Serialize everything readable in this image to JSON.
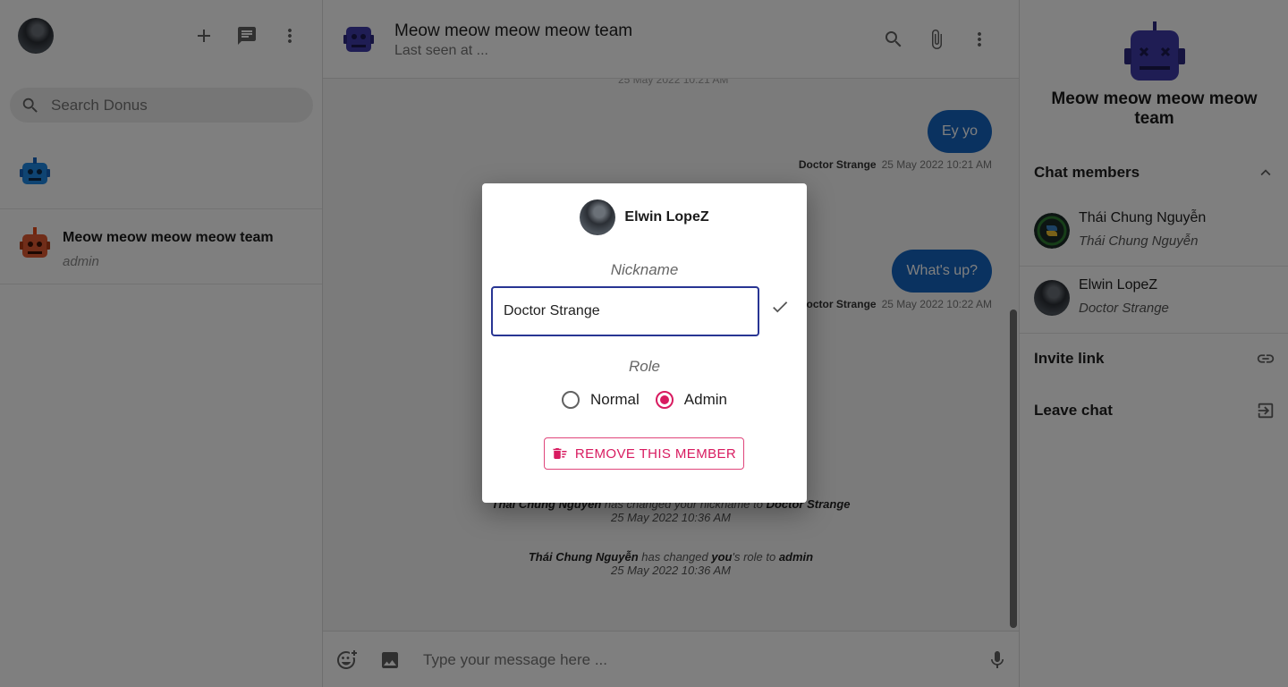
{
  "sidebar": {
    "search_placeholder": "Search Donus",
    "conversations": [
      {
        "name": "",
        "subtitle": ""
      },
      {
        "name": "Meow meow meow meow team",
        "subtitle": "admin"
      }
    ]
  },
  "chat": {
    "title": "Meow meow meow meow team",
    "status": "Last seen at ...",
    "top_stamp": "25 May 2022 10:21 AM",
    "messages": [
      {
        "text": "Ey yo",
        "sender": "Doctor Strange",
        "time": "25 May 2022 10:21 AM"
      },
      {
        "text": "What's up?",
        "sender": "Doctor Strange",
        "time": "25 May 2022 10:22 AM"
      }
    ],
    "system_messages": [
      {
        "actor": "Thái Chung Nguyễn",
        "text": "has changed your nickname to",
        "target": "Doctor Strange",
        "time": "25 May 2022 10:36 AM"
      },
      {
        "actor": "Thái Chung Nguyễn",
        "text": "has changed",
        "target_you": "you",
        "text2": "'s role to",
        "target": "admin",
        "time": "25 May 2022 10:36 AM"
      }
    ],
    "composer_placeholder": "Type your message here ..."
  },
  "info_panel": {
    "title": "Meow meow meow meow team",
    "members_label": "Chat members",
    "members": [
      {
        "name": "Thái Chung Nguyễn",
        "nickname": "Thái Chung Nguyễn"
      },
      {
        "name": "Elwin LopeZ",
        "nickname": "Doctor Strange"
      }
    ],
    "invite_label": "Invite link",
    "leave_label": "Leave chat"
  },
  "dialog": {
    "user_name": "Elwin LopeZ",
    "nickname_label": "Nickname",
    "nickname_value": "Doctor Strange",
    "role_label": "Role",
    "roles": [
      "Normal",
      "Admin"
    ],
    "selected_role": "Admin",
    "remove_label": "REMOVE THIS MEMBER"
  },
  "colors": {
    "accent_blue": "#1565c0",
    "accent_pink": "#d81b60",
    "input_border": "#283593",
    "overlay": "rgba(0,0,0,0.5)"
  },
  "icons": [
    "plus-icon",
    "chat-icon",
    "more-vert-icon",
    "search-icon",
    "attach-icon",
    "emoji-add-icon",
    "image-icon",
    "mic-icon",
    "chevron-up-icon",
    "link-icon",
    "exit-icon",
    "check-icon",
    "delete-sweep-icon"
  ]
}
